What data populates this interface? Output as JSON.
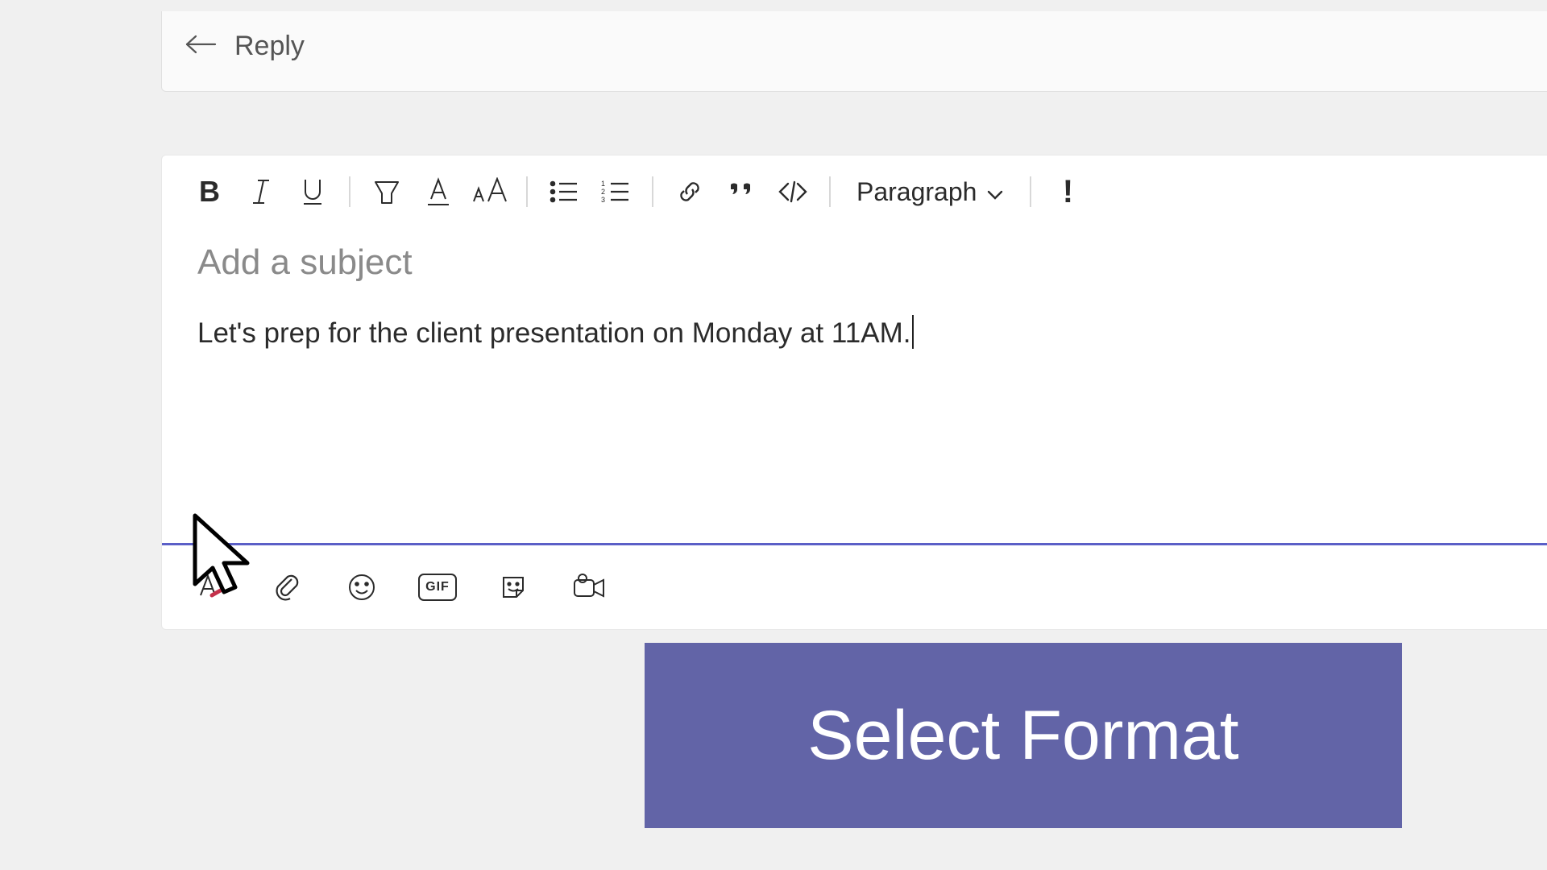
{
  "reply": {
    "label": "Reply"
  },
  "toolbar": {
    "bold": "B",
    "paragraph_label": "Paragraph"
  },
  "compose": {
    "subject_placeholder": "Add a subject",
    "body_text": "Let's prep for the client presentation on Monday at 11AM."
  },
  "bottom": {
    "gif": "GIF"
  },
  "callout": {
    "word1": "Select",
    "word2": "Format"
  }
}
